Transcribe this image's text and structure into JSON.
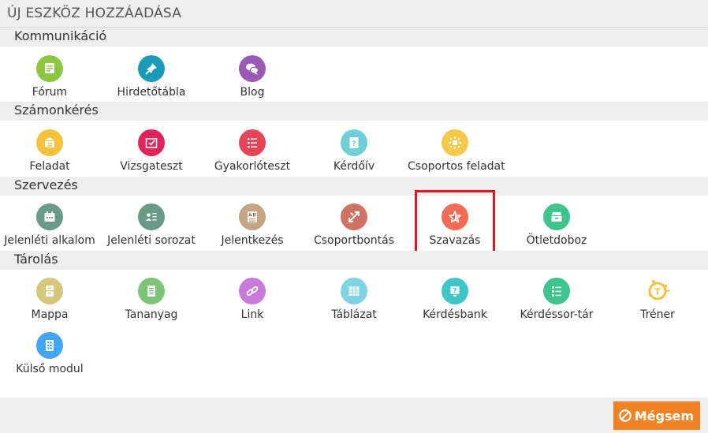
{
  "title": "ÚJ ESZKÖZ HOZZÁADÁSA",
  "categories": [
    {
      "name": "Kommunikáció",
      "items": [
        {
          "label": "Fórum",
          "icon": "forum-icon",
          "color": "#8dc63f"
        },
        {
          "label": "Hirdetőtábla",
          "icon": "pin-icon",
          "color": "#1a9bb9"
        },
        {
          "label": "Blog",
          "icon": "chat-bubbles-icon",
          "color": "#9b59b6"
        }
      ]
    },
    {
      "name": "Számonkérés",
      "items": [
        {
          "label": "Feladat",
          "icon": "task-tray-icon",
          "color": "#f5c23b"
        },
        {
          "label": "Vizsgateszt",
          "icon": "exam-check-icon",
          "color": "#e0235b"
        },
        {
          "label": "Gyakorlóteszt",
          "icon": "checklist-icon",
          "color": "#e64457"
        },
        {
          "label": "Kérdőív",
          "icon": "questionnaire-icon",
          "color": "#6fcfd6"
        },
        {
          "label": "Csoportos feladat",
          "icon": "group-task-icon",
          "color": "#f7c948"
        }
      ]
    },
    {
      "name": "Szervezés",
      "items": [
        {
          "label": "Jelenléti alkalom",
          "icon": "calendar-icon",
          "color": "#6a9a88"
        },
        {
          "label": "Jelenléti sorozat",
          "icon": "attendance-list-icon",
          "color": "#6a9a88"
        },
        {
          "label": "Jelentkezés",
          "icon": "ab-sign-up-icon",
          "color": "#c4a484"
        },
        {
          "label": "Csoportbontás",
          "icon": "split-arrows-icon",
          "color": "#cf7263"
        },
        {
          "label": "Szavazás",
          "icon": "star-vote-icon",
          "color": "#f26b55"
        },
        {
          "label": "Ötletdoboz",
          "icon": "idea-box-icon",
          "color": "#3ec58e"
        }
      ]
    },
    {
      "name": "Tárolás",
      "items": [
        {
          "label": "Mappa",
          "icon": "folder-icon",
          "color": "#d6c87a"
        },
        {
          "label": "Tananyag",
          "icon": "material-icon",
          "color": "#7cc576"
        },
        {
          "label": "Link",
          "icon": "link-icon",
          "color": "#c77ad9"
        },
        {
          "label": "Táblázat",
          "icon": "table-icon",
          "color": "#7fd4e3"
        },
        {
          "label": "Kérdésbank",
          "icon": "question-bank-icon",
          "color": "#3fc6c6"
        },
        {
          "label": "Kérdéssor-tár",
          "icon": "question-list-icon",
          "color": "#3ec58e"
        },
        {
          "label": "Tréner",
          "icon": "trainer-icon",
          "color": "#f5c23b"
        },
        {
          "label": "Külső modul",
          "icon": "external-module-icon",
          "color": "#42a5f5"
        }
      ]
    }
  ],
  "selected": "Szavazás",
  "highlight_color": "#e3141b",
  "cancel_label": "Mégsem",
  "cancel_color": "#f08224"
}
